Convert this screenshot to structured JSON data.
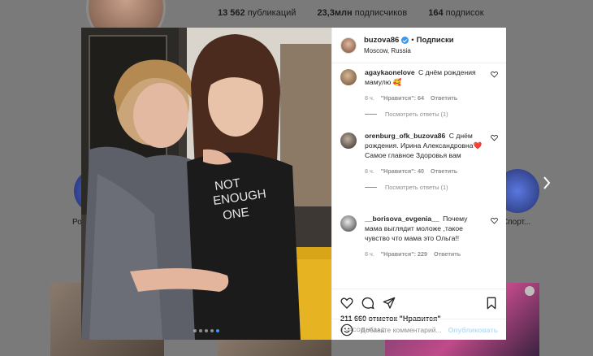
{
  "profile_bg": {
    "stats": [
      {
        "count": "13 562",
        "label": "публикаций"
      },
      {
        "count": "23,3млн",
        "label": "подписчиков"
      },
      {
        "count": "164",
        "label": "подписок"
      }
    ],
    "story_left_label": "Ро",
    "story_right_label": "Спорт..."
  },
  "post": {
    "author": "buzova86",
    "follow_label": "Подписки",
    "location": "Moscow, Russia",
    "photo_tshirt_text": "NOT ENOUGH ONE",
    "carousel_count": 5,
    "carousel_active_index": 4,
    "likes": "211 660 отметок \"Нравится\"",
    "time": "8 ЧАСОВ НАЗАД",
    "add_comment_placeholder": "Добавьте комментарий...",
    "publish_label": "Опубликовать"
  },
  "comments": [
    {
      "user": "agaykaonelove",
      "text": "С днём рождения мамулю 🥰",
      "time": "8 ч.",
      "likes": "\"Нравится\": 64",
      "reply": "Ответить",
      "replies": "Посмотреть ответы (1)"
    },
    {
      "user": "orenburg_ofk_buzova86",
      "text": "С днём рождения. Ирина Александровна❤️ Самое главное Здоровья вам",
      "time": "8 ч.",
      "likes": "\"Нравится\": 40",
      "reply": "Ответить",
      "replies": "Посмотреть ответы (1)"
    },
    {
      "user": "__borisova_evgenia__",
      "text": "Почему мама выглядит моложе ,такое чувство что мама это Ольга!!",
      "time": "8 ч.",
      "likes": "\"Нравится\": 229",
      "reply": "Ответить",
      "replies": ""
    }
  ]
}
